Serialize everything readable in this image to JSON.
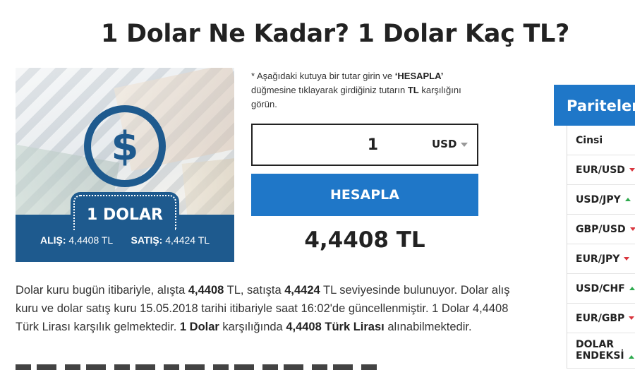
{
  "page_title": "1 Dolar Ne Kadar? 1 Dolar Kaç TL?",
  "card": {
    "label": "1 DOLAR",
    "alis_label": "ALIŞ:",
    "alis_value": "4,4408 TL",
    "satis_label": "SATIŞ:",
    "satis_value": "4,4424 TL",
    "icon": "dollar-icon"
  },
  "calculator": {
    "hint_prefix": "* Aşağıdaki kutuya bir tutar girin ve ",
    "hint_button": "‘HESAPLA’",
    "hint_middle": " düğmesine tıklayarak girdiğiniz tutarın ",
    "hint_currency": "TL",
    "hint_suffix": " karşılığını görün.",
    "amount_value": "1",
    "currency_selected": "USD",
    "button_label": "HESAPLA",
    "result": "4,4408 TL"
  },
  "description": {
    "t1": "Dolar kuru bugün itibariyle, alışta ",
    "b1": "4,4408",
    "t2": " TL, satışta ",
    "b2": "4,4424",
    "t3": " TL seviyesinde bulunuyor. Dolar alış kuru ve dolar satış kuru 15.05.2018 tarihi itibariyle saat 16:02'de güncellenmiştir. 1 Dolar 4,4408 Türk Lirası karşılık gelmektedir. ",
    "b3": "1 Dolar",
    "t4": " karşılığında ",
    "b4": "4,4408 Türk Lirası",
    "t5": " alınabilmektedir."
  },
  "sidebar": {
    "title": "Pariteler",
    "column_header": "Cinsi",
    "pairs": [
      {
        "name": "EUR/USD",
        "trend": "down"
      },
      {
        "name": "USD/JPY",
        "trend": "up"
      },
      {
        "name": "GBP/USD",
        "trend": "down"
      },
      {
        "name": "EUR/JPY",
        "trend": "down"
      },
      {
        "name": "USD/CHF",
        "trend": "up"
      },
      {
        "name": "EUR/GBP",
        "trend": "down"
      },
      {
        "name_line1": "DOLAR",
        "name_line2": "ENDEKSİ",
        "trend": "up"
      }
    ]
  },
  "colors": {
    "brand_blue": "#1f77c8",
    "card_blue": "#1e5a8e",
    "trend_up": "#2eaa4e",
    "trend_down": "#d9363e"
  }
}
